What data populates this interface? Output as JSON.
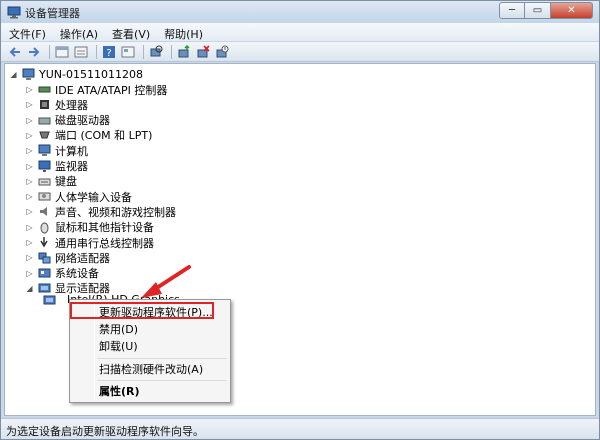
{
  "window": {
    "title": "设备管理器",
    "controls": {
      "minimize": "─",
      "maximize": "▭",
      "close": "✕"
    }
  },
  "menubar": [
    {
      "label": "文件(F)"
    },
    {
      "label": "操作(A)"
    },
    {
      "label": "查看(V)"
    },
    {
      "label": "帮助(H)"
    }
  ],
  "toolbar_icons": [
    "back-arrow-icon",
    "forward-arrow-icon",
    "properties-icon",
    "refresh-icon",
    "help-icon",
    "show-hidden-icon",
    "scan-hardware-icon",
    "update-driver-icon",
    "uninstall-icon",
    "disable-icon"
  ],
  "tree": {
    "root": "YUN-01511011208",
    "items": [
      {
        "label": "IDE ATA/ATAPI 控制器",
        "icon": "ide-controller-icon"
      },
      {
        "label": "处理器",
        "icon": "processor-icon"
      },
      {
        "label": "磁盘驱动器",
        "icon": "disk-drive-icon"
      },
      {
        "label": "端口 (COM 和 LPT)",
        "icon": "port-icon"
      },
      {
        "label": "计算机",
        "icon": "computer-icon"
      },
      {
        "label": "监视器",
        "icon": "monitor-icon"
      },
      {
        "label": "键盘",
        "icon": "keyboard-icon"
      },
      {
        "label": "人体学输入设备",
        "icon": "hid-icon"
      },
      {
        "label": "声音、视频和游戏控制器",
        "icon": "sound-icon"
      },
      {
        "label": "鼠标和其他指针设备",
        "icon": "mouse-icon"
      },
      {
        "label": "通用串行总线控制器",
        "icon": "usb-icon"
      },
      {
        "label": "网络适配器",
        "icon": "network-icon"
      },
      {
        "label": "系统设备",
        "icon": "system-device-icon"
      },
      {
        "label": "显示适配器",
        "icon": "display-adapter-icon"
      }
    ],
    "child": "Intel(R) HD Graphics"
  },
  "context_menu": {
    "update_driver": "更新驱动程序软件(P)...",
    "disable": "禁用(D)",
    "uninstall": "卸载(U)",
    "scan": "扫描检测硬件改动(A)",
    "properties": "属性(R)"
  },
  "statusbar": {
    "text": "为选定设备启动更新驱动程序软件向导。"
  },
  "colors": {
    "highlight": "#e02323",
    "arrow": "#e02323"
  }
}
